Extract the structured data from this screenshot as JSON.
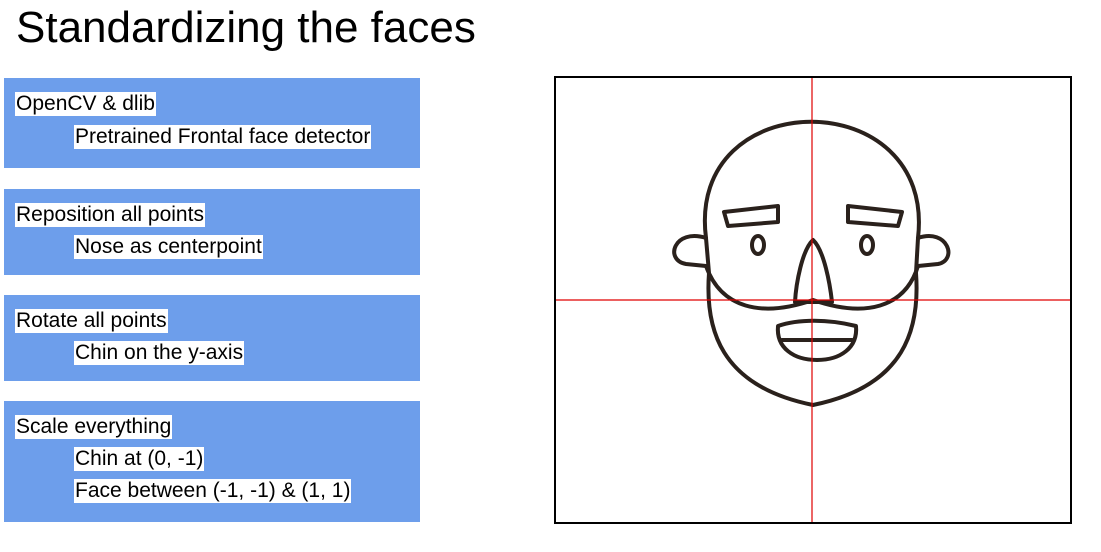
{
  "slide": {
    "title": "Standardizing the faces"
  },
  "steps": [
    {
      "title": "OpenCV & dlib",
      "details": [
        "Pretrained Frontal face detector"
      ]
    },
    {
      "title": "Reposition all points",
      "details": [
        "Nose as centerpoint"
      ]
    },
    {
      "title": "Rotate all points",
      "details": [
        "Chin on the y-axis"
      ]
    },
    {
      "title": "Scale everything",
      "details": [
        "Chin at (0, -1)",
        "Face between (-1, -1) & (1, 1)"
      ]
    }
  ],
  "figure": {
    "icon": "bearded-face-icon",
    "axis_color": "#e00000",
    "line_color": "#2a211c"
  },
  "colors": {
    "step_box": "#6d9eeb",
    "label_background": "#ffffff"
  }
}
